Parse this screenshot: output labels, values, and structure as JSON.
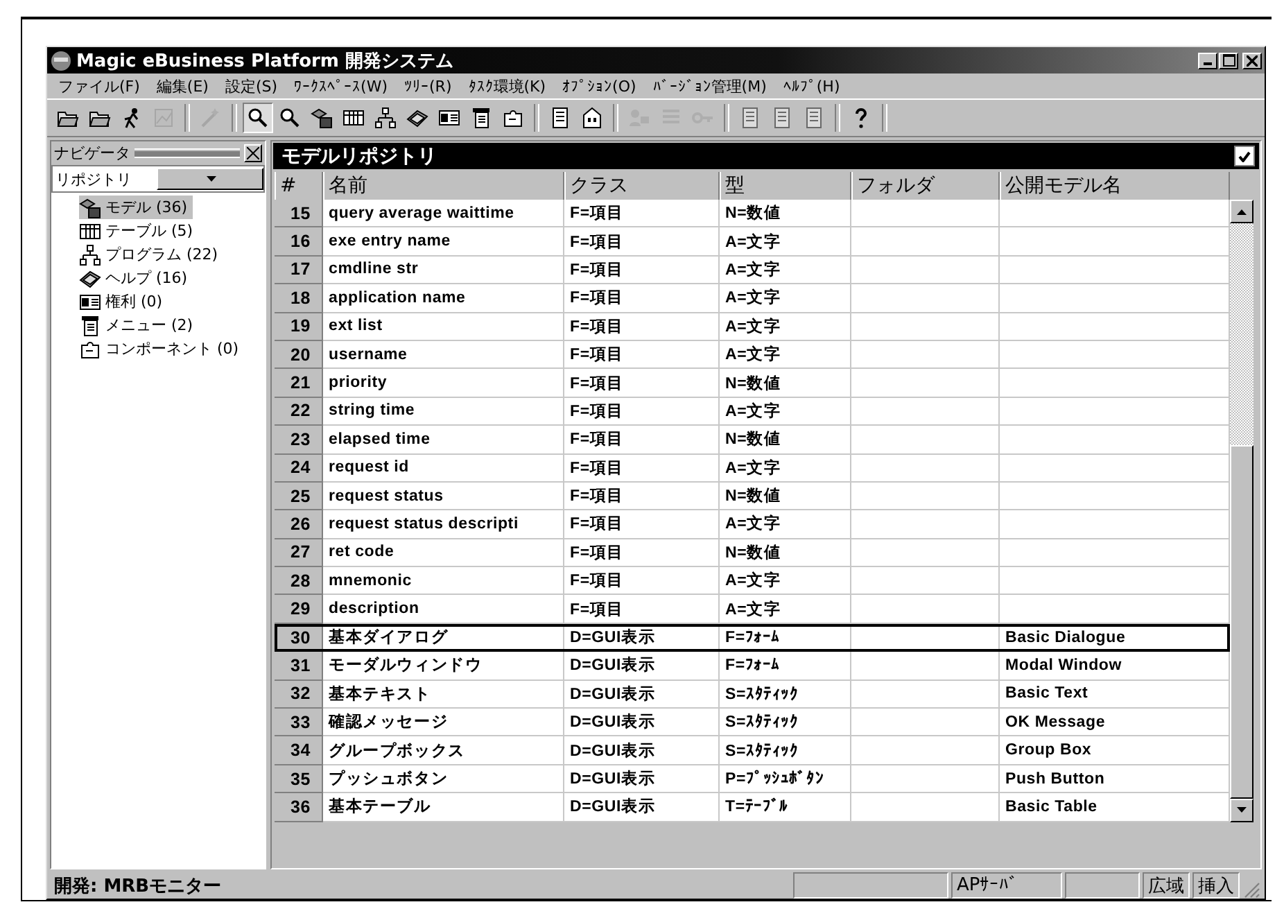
{
  "window": {
    "title": "Magic eBusiness Platform 開発システム"
  },
  "menu": [
    {
      "label": "ファイル(F)"
    },
    {
      "label": "編集(E)"
    },
    {
      "label": "設定(S)"
    },
    {
      "label": "ﾜｰｸｽﾍﾟｰｽ(W)"
    },
    {
      "label": "ﾂﾘｰ(R)"
    },
    {
      "label": "ﾀｽｸ環境(K)"
    },
    {
      "label": "ｵﾌﾟｼｮﾝ(O)"
    },
    {
      "label": "ﾊﾞｰｼﾞｮﾝ管理(M)"
    },
    {
      "label": "ﾍﾙﾌﾟ(H)"
    }
  ],
  "toolbar": [
    {
      "kind": "folder",
      "disabled": false,
      "pressed": false
    },
    {
      "kind": "folder",
      "disabled": false,
      "pressed": false
    },
    {
      "kind": "runner",
      "disabled": false,
      "pressed": false
    },
    {
      "kind": "chart",
      "disabled": true,
      "pressed": false
    },
    {
      "kind": "separator"
    },
    {
      "kind": "wand",
      "disabled": true,
      "pressed": false
    },
    {
      "kind": "separator"
    },
    {
      "kind": "search",
      "disabled": false,
      "pressed": true
    },
    {
      "kind": "search",
      "disabled": false,
      "pressed": false
    },
    {
      "kind": "model",
      "disabled": false,
      "pressed": false
    },
    {
      "kind": "table",
      "disabled": false,
      "pressed": false
    },
    {
      "kind": "tree",
      "disabled": false,
      "pressed": false
    },
    {
      "kind": "book",
      "disabled": false,
      "pressed": false
    },
    {
      "kind": "card",
      "disabled": false,
      "pressed": false
    },
    {
      "kind": "menu",
      "disabled": false,
      "pressed": false
    },
    {
      "kind": "puzzle",
      "disabled": false,
      "pressed": false
    },
    {
      "kind": "separator"
    },
    {
      "kind": "document",
      "disabled": false,
      "pressed": false
    },
    {
      "kind": "building",
      "disabled": false,
      "pressed": false
    },
    {
      "kind": "separator"
    },
    {
      "kind": "person",
      "disabled": true,
      "pressed": false
    },
    {
      "kind": "list",
      "disabled": true,
      "pressed": false
    },
    {
      "kind": "key",
      "disabled": true,
      "pressed": false
    },
    {
      "kind": "separator"
    },
    {
      "kind": "document",
      "disabled": true,
      "pressed": false
    },
    {
      "kind": "document",
      "disabled": true,
      "pressed": false
    },
    {
      "kind": "document",
      "disabled": true,
      "pressed": false
    },
    {
      "kind": "separator"
    },
    {
      "kind": "help",
      "disabled": false,
      "pressed": false
    },
    {
      "kind": "separator"
    }
  ],
  "navigator": {
    "title": "ナビゲータ",
    "dropdown": {
      "value": "リポジトリ"
    },
    "items": [
      {
        "label": "モデル (36)",
        "kind": "model",
        "selected": true
      },
      {
        "label": "テーブル (5)",
        "kind": "table",
        "selected": false
      },
      {
        "label": "プログラム (22)",
        "kind": "tree",
        "selected": false
      },
      {
        "label": "ヘルプ (16)",
        "kind": "book",
        "selected": false
      },
      {
        "label": "権利 (0)",
        "kind": "card",
        "selected": false
      },
      {
        "label": "メニュー (2)",
        "kind": "menu",
        "selected": false
      },
      {
        "label": "コンポーネント (0)",
        "kind": "puzzle",
        "selected": false
      }
    ]
  },
  "grid": {
    "title": "モデルリポジトリ",
    "checked": true,
    "columns": [
      "#",
      "名前",
      "クラス",
      "型",
      "フォルダ",
      "公開モデル名"
    ],
    "rows": [
      {
        "number": "15",
        "name": "query average waittime",
        "class": "F=項目",
        "type": "N=数値",
        "selected": false
      },
      {
        "number": "16",
        "name": "exe entry name",
        "class": "F=項目",
        "type": "A=文字",
        "selected": false
      },
      {
        "number": "17",
        "name": "cmdline str",
        "class": "F=項目",
        "type": "A=文字",
        "selected": false
      },
      {
        "number": "18",
        "name": "application name",
        "class": "F=項目",
        "type": "A=文字",
        "selected": false
      },
      {
        "number": "19",
        "name": "ext list",
        "class": "F=項目",
        "type": "A=文字",
        "selected": false
      },
      {
        "number": "20",
        "name": "username",
        "class": "F=項目",
        "type": "A=文字",
        "selected": false
      },
      {
        "number": "21",
        "name": "priority",
        "class": "F=項目",
        "type": "N=数値",
        "selected": false
      },
      {
        "number": "22",
        "name": "string time",
        "class": "F=項目",
        "type": "A=文字",
        "selected": false
      },
      {
        "number": "23",
        "name": "elapsed time",
        "class": "F=項目",
        "type": "N=数値",
        "selected": false
      },
      {
        "number": "24",
        "name": "request id",
        "class": "F=項目",
        "type": "A=文字",
        "selected": false
      },
      {
        "number": "25",
        "name": "request status",
        "class": "F=項目",
        "type": "N=数値",
        "selected": false
      },
      {
        "number": "26",
        "name": "request status descripti",
        "class": "F=項目",
        "type": "A=文字",
        "selected": false
      },
      {
        "number": "27",
        "name": "ret code",
        "class": "F=項目",
        "type": "N=数値",
        "selected": false
      },
      {
        "number": "28",
        "name": "mnemonic",
        "class": "F=項目",
        "type": "A=文字",
        "selected": false
      },
      {
        "number": "29",
        "name": "description",
        "class": "F=項目",
        "type": "A=文字",
        "selected": false
      },
      {
        "number": "30",
        "name": "基本ダイアログ",
        "class": "D=GUI表示",
        "type": "F=ﾌｫｰﾑ",
        "public_name": "Basic Dialogue",
        "selected": true
      },
      {
        "number": "31",
        "name": "モーダルウィンドウ",
        "class": "D=GUI表示",
        "type": "F=ﾌｫｰﾑ",
        "public_name": "Modal Window",
        "selected": false
      },
      {
        "number": "32",
        "name": "基本テキスト",
        "class": "D=GUI表示",
        "type": "S=ｽﾀﾃｨｯｸ",
        "public_name": "Basic Text",
        "selected": false
      },
      {
        "number": "33",
        "name": "確認メッセージ",
        "class": "D=GUI表示",
        "type": "S=ｽﾀﾃｨｯｸ",
        "public_name": "OK Message",
        "selected": false
      },
      {
        "number": "34",
        "name": "グループボックス",
        "class": "D=GUI表示",
        "type": "S=ｽﾀﾃｨｯｸ",
        "public_name": "Group Box",
        "selected": false
      },
      {
        "number": "35",
        "name": "プッシュボタン",
        "class": "D=GUI表示",
        "type": "P=ﾌﾟｯｼｭﾎﾞﾀﾝ",
        "public_name": "Push Button",
        "selected": false
      },
      {
        "number": "36",
        "name": "基本テーブル",
        "class": "D=GUI表示",
        "type": "T=ﾃｰﾌﾞﾙ",
        "public_name": "Basic Table",
        "selected": false
      }
    ]
  },
  "status_bar": {
    "message": "開発: MRBモニター",
    "panels": [
      "APｻｰﾊﾞ",
      "広域",
      "挿入"
    ]
  }
}
